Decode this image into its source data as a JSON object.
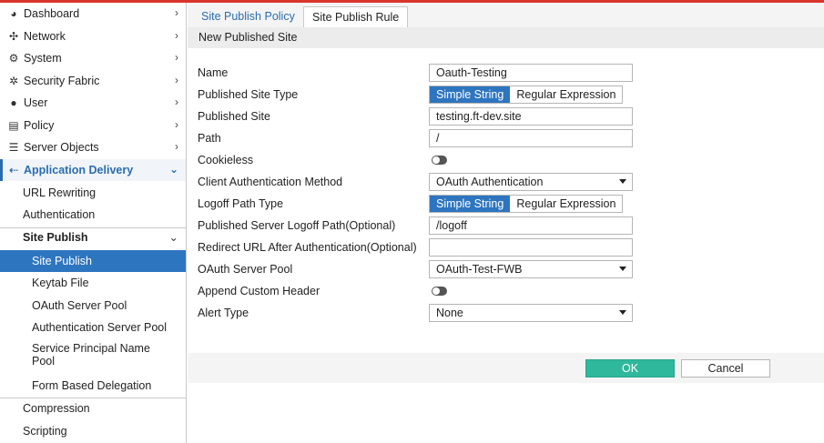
{
  "sidebar": {
    "items": [
      {
        "label": "Dashboard",
        "icon": "dashboard-icon"
      },
      {
        "label": "Network",
        "icon": "network-icon"
      },
      {
        "label": "System",
        "icon": "gear-icon"
      },
      {
        "label": "Security Fabric",
        "icon": "security-fabric-icon"
      },
      {
        "label": "User",
        "icon": "user-icon"
      },
      {
        "label": "Policy",
        "icon": "policy-icon"
      },
      {
        "label": "Server Objects",
        "icon": "server-icon"
      },
      {
        "label": "Application Delivery",
        "icon": "application-delivery-icon"
      }
    ],
    "app_delivery_sub": [
      "URL Rewriting",
      "Authentication",
      "Site Publish"
    ],
    "site_publish_sub": [
      "Site Publish",
      "Keytab File",
      "OAuth Server Pool",
      "Authentication Server Pool",
      "Service Principal Name Pool",
      "Form Based Delegation"
    ],
    "bottom_items": [
      "Compression",
      "Scripting"
    ]
  },
  "tabs": [
    {
      "label": "Site Publish Policy",
      "active": false
    },
    {
      "label": "Site Publish Rule",
      "active": true
    }
  ],
  "header": {
    "title": "New Published Site"
  },
  "form": {
    "name": {
      "label": "Name",
      "value": "Oauth-Testing"
    },
    "published_site_type": {
      "label": "Published Site Type",
      "options": [
        "Simple String",
        "Regular Expression"
      ],
      "selected": "Simple String"
    },
    "published_site": {
      "label": "Published Site",
      "value": "testing.ft-dev.site"
    },
    "path": {
      "label": "Path",
      "value": "/"
    },
    "cookieless": {
      "label": "Cookieless",
      "enabled": false
    },
    "client_auth_method": {
      "label": "Client Authentication Method",
      "value": "OAuth Authentication"
    },
    "logoff_path_type": {
      "label": "Logoff Path Type",
      "options": [
        "Simple String",
        "Regular Expression"
      ],
      "selected": "Simple String"
    },
    "logoff_path": {
      "label": "Published Server Logoff Path(Optional)",
      "value": "/logoff"
    },
    "redirect_url": {
      "label": "Redirect URL After Authentication(Optional)",
      "value": ""
    },
    "oauth_server_pool": {
      "label": "OAuth Server Pool",
      "value": "OAuth-Test-FWB"
    },
    "append_custom_header": {
      "label": "Append Custom Header",
      "enabled": false
    },
    "alert_type": {
      "label": "Alert Type",
      "value": "None"
    }
  },
  "buttons": {
    "ok": "OK",
    "cancel": "Cancel"
  },
  "colors": {
    "accent": "#2e75c0",
    "ok_button": "#2fb89b",
    "top_bar": "#d9362b"
  }
}
